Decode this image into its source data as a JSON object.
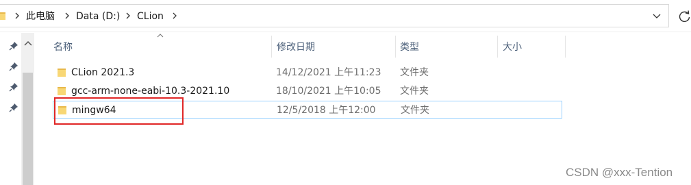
{
  "address_bar": {
    "crumbs": [
      "此电脑",
      "Data (D:)",
      "CLion"
    ]
  },
  "columns": {
    "name": "名称",
    "date": "修改日期",
    "type": "类型",
    "size": "大小"
  },
  "files": [
    {
      "name": "CLion 2021.3",
      "date": "14/12/2021 上午11:23",
      "type": "文件夹",
      "icon": "folder-icon"
    },
    {
      "name": "gcc-arm-none-eabi-10.3-2021.10",
      "date": "18/10/2021 上午10:05",
      "type": "文件夹",
      "icon": "folder-icon"
    },
    {
      "name": "mingw64",
      "date": "12/5/2018 上午12:00",
      "type": "文件夹",
      "icon": "folder-icon",
      "selected": true
    }
  ],
  "watermark": "CSDN @xxx-Tention",
  "colors": {
    "folder": "#f8d775",
    "selection_border": "#99d1ff",
    "highlight": "#e02727"
  }
}
